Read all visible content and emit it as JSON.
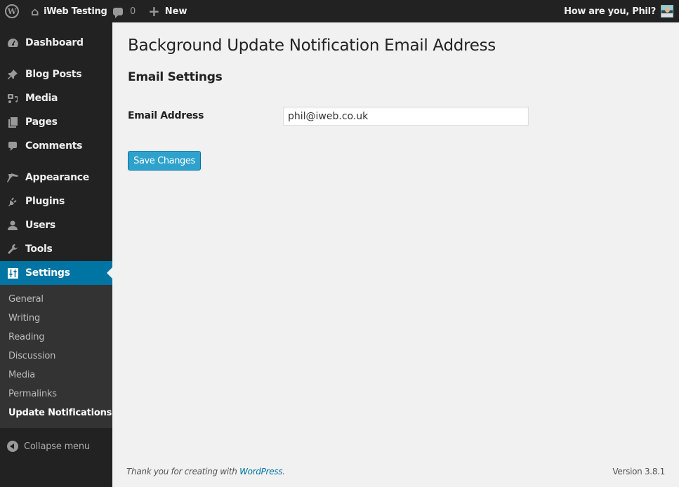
{
  "adminbar": {
    "site_name": "iWeb Testing",
    "comments_count": "0",
    "new_label": "New",
    "greeting": "How are you, Phil?"
  },
  "sidebar": {
    "items": [
      {
        "label": "Dashboard",
        "icon": "dashboard-icon"
      },
      {
        "label": "Blog Posts",
        "icon": "pin-icon"
      },
      {
        "label": "Media",
        "icon": "media-icon"
      },
      {
        "label": "Pages",
        "icon": "pages-icon"
      },
      {
        "label": "Comments",
        "icon": "comment-icon"
      },
      {
        "label": "Appearance",
        "icon": "paintbrush-icon"
      },
      {
        "label": "Plugins",
        "icon": "plug-icon"
      },
      {
        "label": "Users",
        "icon": "user-icon"
      },
      {
        "label": "Tools",
        "icon": "wrench-icon"
      },
      {
        "label": "Settings",
        "icon": "sliders-icon",
        "current": true
      }
    ],
    "submenu": [
      {
        "label": "General"
      },
      {
        "label": "Writing"
      },
      {
        "label": "Reading"
      },
      {
        "label": "Discussion"
      },
      {
        "label": "Media"
      },
      {
        "label": "Permalinks"
      },
      {
        "label": "Update Notifications",
        "current": true
      }
    ],
    "collapse_label": "Collapse menu"
  },
  "main": {
    "page_title": "Background Update Notification Email Address",
    "section_title": "Email Settings",
    "email_label": "Email Address",
    "email_value": "phil@iweb.co.uk",
    "save_label": "Save Changes"
  },
  "footer": {
    "thanks_prefix": "Thank you for creating with ",
    "thanks_link": "WordPress",
    "thanks_suffix": ".",
    "version": "Version 3.8.1"
  },
  "colors": {
    "accent": "#0074a2",
    "button": "#2ea2cc",
    "adminbar_bg": "#222222",
    "submenu_bg": "#333333",
    "page_bg": "#f1f1f1"
  }
}
